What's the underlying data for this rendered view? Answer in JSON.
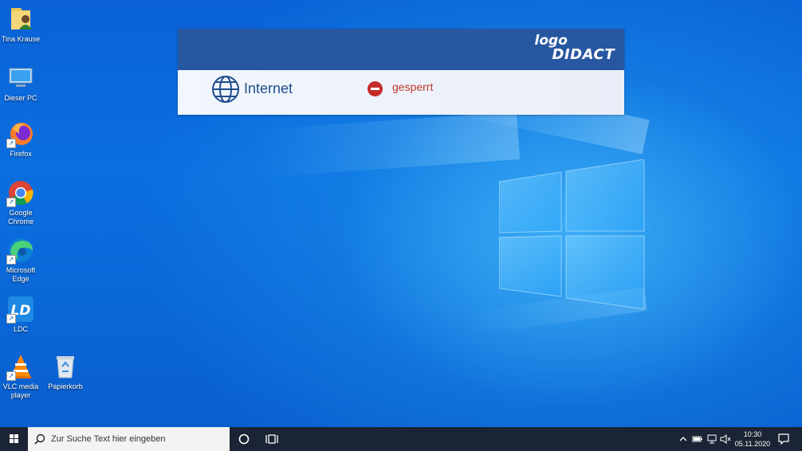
{
  "desktop": {
    "icons": [
      {
        "label": "Tina Krause",
        "icon": "user-folder-icon"
      },
      {
        "label": "Dieser PC",
        "icon": "this-pc-icon"
      },
      {
        "label": "Firefox",
        "icon": "firefox-icon"
      },
      {
        "label": "Google\nChrome",
        "icon": "chrome-icon"
      },
      {
        "label": "Microsoft\nEdge",
        "icon": "edge-icon"
      },
      {
        "label": "LDC",
        "icon": "ldc-icon"
      },
      {
        "label": "VLC media\nplayer",
        "icon": "vlc-icon"
      },
      {
        "label": "Papierkorb",
        "icon": "recycle-bin-icon"
      }
    ]
  },
  "panel": {
    "logo_line1": "logo",
    "logo_line2": "DIDACT",
    "service_label": "Internet",
    "status_label": "gesperrt",
    "colors": {
      "header": "#2857a2",
      "status": "#c62a2a"
    }
  },
  "taskbar": {
    "search_placeholder": "Zur Suche Text hier eingeben",
    "time": "10:30",
    "date": "05.11.2020"
  }
}
